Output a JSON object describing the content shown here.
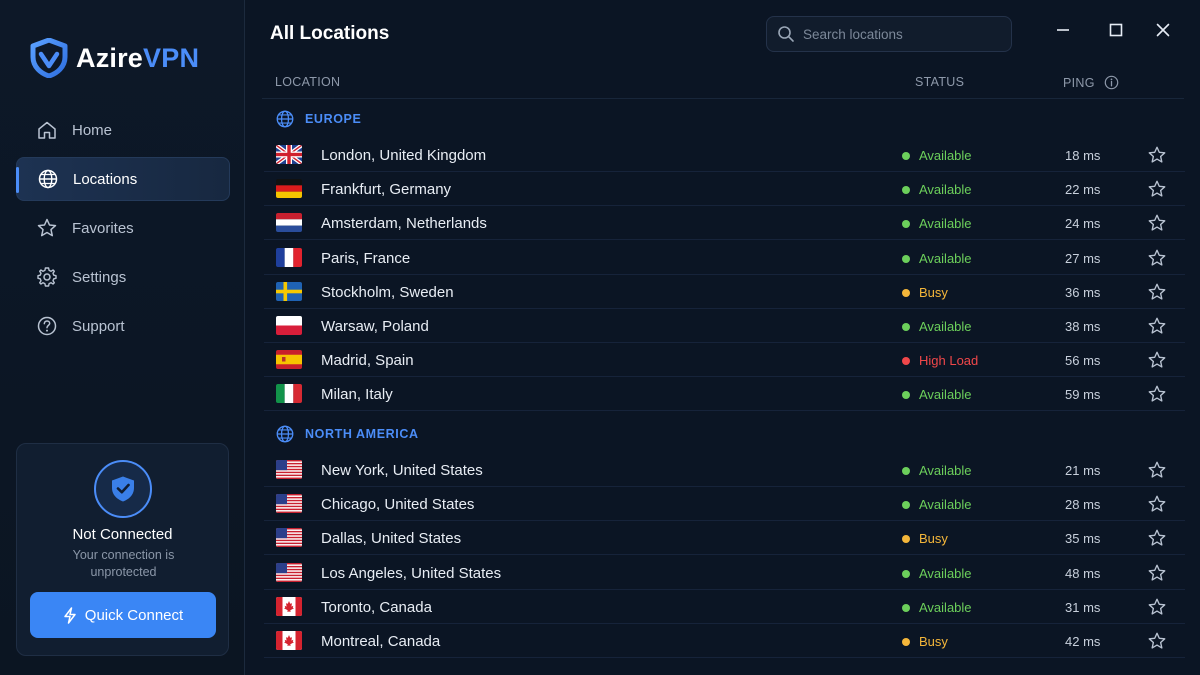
{
  "app": {
    "logo_part1": "Azire",
    "logo_part2": "VPN"
  },
  "nav": [
    {
      "label": "Home",
      "icon": "home-icon",
      "active": false
    },
    {
      "label": "Locations",
      "icon": "globe-icon",
      "active": true
    },
    {
      "label": "Favorites",
      "icon": "star-icon",
      "active": false
    },
    {
      "label": "Settings",
      "icon": "gear-icon",
      "active": false
    },
    {
      "label": "Support",
      "icon": "help-icon",
      "active": false
    }
  ],
  "connection": {
    "title": "Not Connected",
    "subtitle": "Your connection is unprotected",
    "button_label": "Quick Connect"
  },
  "main": {
    "title": "All Locations",
    "search_placeholder": "Search locations",
    "columns": {
      "location": "LOCATION",
      "status": "STATUS",
      "ping": "PING"
    }
  },
  "status_colors": {
    "Available": "#6ccf5b",
    "Busy": "#f4b63a",
    "High Load": "#f0474a"
  },
  "accent": "#4b8df8",
  "regions": [
    {
      "name": "EUROPE",
      "locations": [
        {
          "name": "London, United Kingdom",
          "flag": "uk",
          "status": "Available",
          "ping": "18 ms"
        },
        {
          "name": "Frankfurt, Germany",
          "flag": "de",
          "status": "Available",
          "ping": "22 ms"
        },
        {
          "name": "Amsterdam, Netherlands",
          "flag": "nl",
          "status": "Available",
          "ping": "24 ms"
        },
        {
          "name": "Paris, France",
          "flag": "fr",
          "status": "Available",
          "ping": "27 ms"
        },
        {
          "name": "Stockholm, Sweden",
          "flag": "se",
          "status": "Busy",
          "ping": "36 ms"
        },
        {
          "name": "Warsaw, Poland",
          "flag": "pl",
          "status": "Available",
          "ping": "38 ms"
        },
        {
          "name": "Madrid, Spain",
          "flag": "es",
          "status": "High Load",
          "ping": "56 ms"
        },
        {
          "name": "Milan, Italy",
          "flag": "it",
          "status": "Available",
          "ping": "59 ms"
        }
      ]
    },
    {
      "name": "NORTH AMERICA",
      "locations": [
        {
          "name": "New York, United States",
          "flag": "us",
          "status": "Available",
          "ping": "21 ms"
        },
        {
          "name": "Chicago, United States",
          "flag": "us",
          "status": "Available",
          "ping": "28 ms"
        },
        {
          "name": "Dallas, United States",
          "flag": "us",
          "status": "Busy",
          "ping": "35 ms"
        },
        {
          "name": "Los Angeles, United States",
          "flag": "us",
          "status": "Available",
          "ping": "48 ms"
        },
        {
          "name": "Toronto, Canada",
          "flag": "ca",
          "status": "Available",
          "ping": "31 ms"
        },
        {
          "name": "Montreal, Canada",
          "flag": "ca",
          "status": "Busy",
          "ping": "42 ms"
        }
      ]
    }
  ]
}
